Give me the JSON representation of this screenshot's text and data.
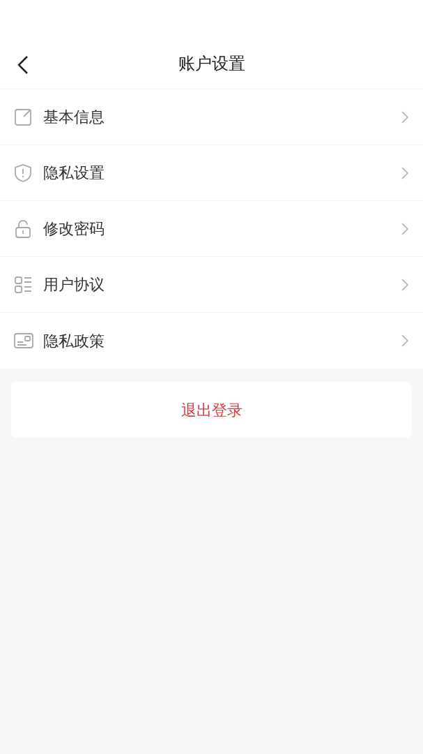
{
  "header": {
    "title": "账户设置"
  },
  "items": [
    {
      "label": "基本信息",
      "kind": "edit"
    },
    {
      "label": "隐私设置",
      "kind": "shield"
    },
    {
      "label": "修改密码",
      "kind": "lock"
    },
    {
      "label": "用户协议",
      "kind": "list"
    },
    {
      "label": "隐私政策",
      "kind": "card"
    }
  ],
  "logout_button": "退出登录"
}
